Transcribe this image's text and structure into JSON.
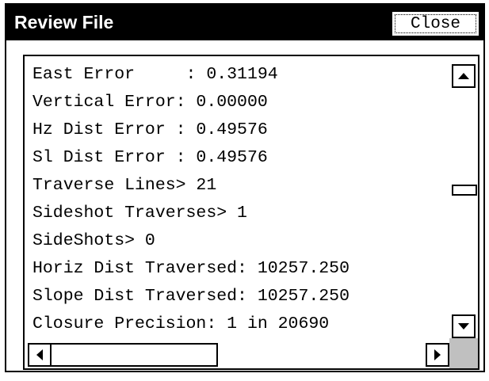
{
  "window": {
    "title": "Review File",
    "close_label": "Close"
  },
  "content": {
    "lines": [
      "East Error     : 0.31194",
      "Vertical Error: 0.00000",
      "Hz Dist Error : 0.49576",
      "Sl Dist Error : 0.49576",
      "Traverse Lines> 21",
      "Sideshot Traverses> 1",
      "SideShots> 0",
      "Horiz Dist Traversed: 10257.250",
      "Slope Dist Traversed: 10257.250",
      "Closure Precision: 1 in 20690"
    ]
  },
  "scrollbars": {
    "vertical": {
      "position_fraction": 0.5,
      "up_icon": "arrow-up-icon",
      "down_icon": "arrow-down-icon"
    },
    "horizontal": {
      "position_fraction": 0.0,
      "left_icon": "arrow-left-icon",
      "right_icon": "arrow-right-icon"
    }
  }
}
